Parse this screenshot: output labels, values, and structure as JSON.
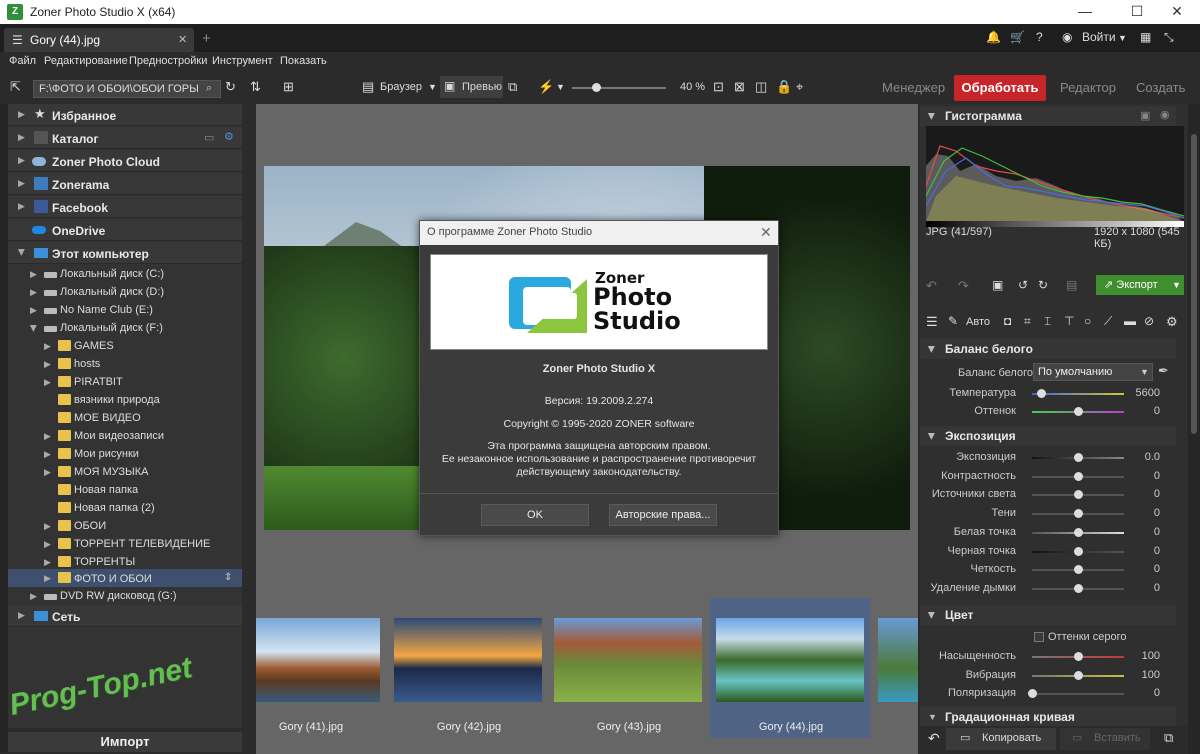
{
  "window": {
    "title": "Zoner Photo Studio X (x64)",
    "minimize": "—",
    "maximize": "☐",
    "close": "✕"
  },
  "tab": {
    "label": "Gory (44).jpg",
    "close": "✕",
    "add": "+"
  },
  "top_right": {
    "login": "Войти"
  },
  "menu": [
    "Файл",
    "Редактирование",
    "Предностройки",
    "Инструмент",
    "Показать"
  ],
  "toolbar": {
    "path": "F:\\ФОТО И ОБОИ\\ОБОИ ГОРЫ",
    "browser": "Браузер",
    "preview": "Превью",
    "zoom": "40 %",
    "modes": {
      "manager": "Менеджер",
      "process": "Обработать",
      "editor": "Редактор",
      "create": "Создать"
    }
  },
  "nav": {
    "top": [
      {
        "label": "Избранное",
        "icon": "star-icon"
      },
      {
        "label": "Каталог",
        "icon": "catalog-icon"
      },
      {
        "label": "Zoner Photo Cloud",
        "icon": "cloud-icon"
      },
      {
        "label": "Zonerama",
        "icon": "zonerama-icon"
      },
      {
        "label": "Facebook",
        "icon": "facebook-icon"
      },
      {
        "label": "OneDrive",
        "icon": "onedrive-icon"
      },
      {
        "label": "Этот компьютер",
        "icon": "computer-icon"
      }
    ],
    "drives": [
      "Локальный диск (C:)",
      "Локальный диск (D:)",
      "No Name Club (E:)",
      "Локальный диск (F:)"
    ],
    "folders": [
      "GAMES",
      "hosts",
      "PIRATBIT",
      "вязники природа",
      "МОЕ ВИДЕО",
      "Мои видеозаписи",
      "Мои рисунки",
      "МОЯ МУЗЫКА",
      "Новая папка",
      "Новая папка (2)",
      "ОБОИ",
      "ТОРРЕНТ ТЕЛЕВИДЕНИЕ",
      "ТОРРЕНТЫ",
      "ФОТО И ОБОИ"
    ],
    "dvd": "DVD RW дисковод (G:)",
    "network": "Сеть",
    "import": "Импорт"
  },
  "dialog": {
    "title": "О программе Zoner Photo Studio",
    "logo_line1": "Zoner",
    "logo_line2": "Photo",
    "logo_line3": "Studio",
    "product": "Zoner Photo Studio X",
    "version": "Версия: 19.2009.2.274",
    "copyright": "Copyright © 1995-2020 ZONER software",
    "legal1": "Эта программа защищена авторским правом.",
    "legal2": "Ее незаконное использование и распространение противоречит",
    "legal3": "действующему законодательству.",
    "ok": "OK",
    "rights": "Авторские права..."
  },
  "filmstrip": [
    "Gory (41).jpg",
    "Gory (42).jpg",
    "Gory (43).jpg",
    "Gory (44).jpg"
  ],
  "right": {
    "histogram": "Гистограмма",
    "file_type": "JPG",
    "file_index": "(41/597)",
    "file_dims": "1920 x 1080 (545 КБ)",
    "export": "Экспорт",
    "auto": "Авто",
    "wb": {
      "title": "Баланс белого",
      "preset_label": "Баланс белого",
      "preset_value": "По умолчанию",
      "rows": [
        {
          "label": "Температура",
          "value": "5600",
          "level": 0.1
        },
        {
          "label": "Оттенок",
          "value": "0",
          "level": 0.5
        }
      ]
    },
    "exposure": {
      "title": "Экспозиция",
      "rows": [
        {
          "label": "Экспозиция",
          "value": "0.0",
          "level": 0.5
        },
        {
          "label": "Контрастность",
          "value": "0",
          "level": 0.5
        },
        {
          "label": "Источники света",
          "value": "0",
          "level": 0.5
        },
        {
          "label": "Тени",
          "value": "0",
          "level": 0.5
        },
        {
          "label": "Белая точка",
          "value": "0",
          "level": 0.5
        },
        {
          "label": "Черная точка",
          "value": "0",
          "level": 0.5
        },
        {
          "label": "Четкость",
          "value": "0",
          "level": 0.5
        },
        {
          "label": "Удаление дымки",
          "value": "0",
          "level": 0.5
        }
      ]
    },
    "color": {
      "title": "Цвет",
      "grayscale": "Оттенки серого",
      "rows": [
        {
          "label": "Насыщенность",
          "value": "100",
          "level": 0.5
        },
        {
          "label": "Вибрация",
          "value": "100",
          "level": 0.5
        },
        {
          "label": "Поляризация",
          "value": "0",
          "level": 0.0
        }
      ]
    },
    "curve": "Градационная кривая",
    "copy": "Копировать",
    "paste": "Вставить"
  },
  "watermark": "Prog-Top.net"
}
